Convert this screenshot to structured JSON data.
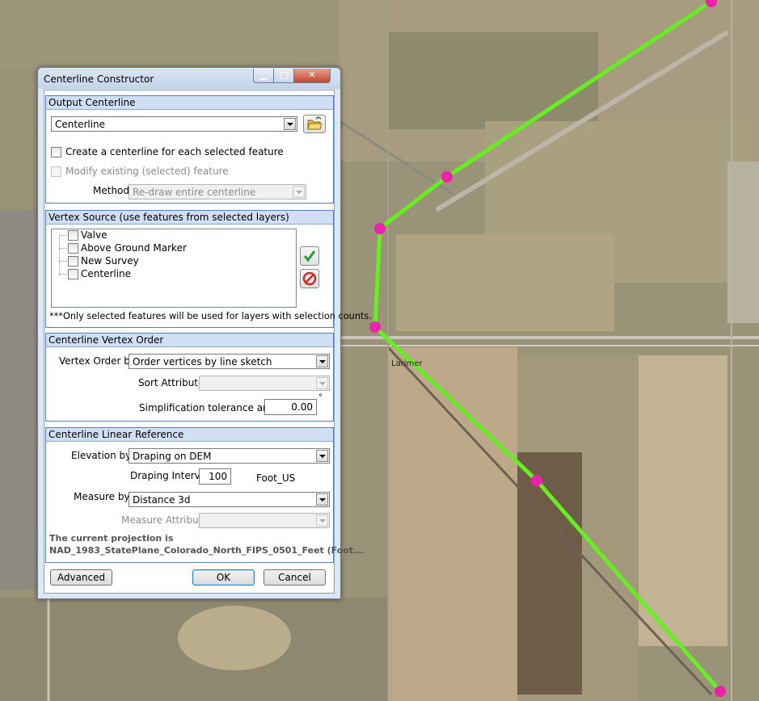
{
  "window": {
    "title": "Centerline Constructor"
  },
  "output": {
    "header": "Output Centerline",
    "layer_value": "Centerline",
    "create_each_label": "Create a centerline for each selected feature",
    "modify_label": "Modify existing (selected) feature",
    "method_label": "Method:",
    "method_value": "Re-draw entire centerline"
  },
  "vertex_source": {
    "header": "Vertex Source (use features from selected layers)",
    "layers": [
      "Valve",
      "Above Ground Marker",
      "New Survey",
      "Centerline"
    ],
    "note": "***Only selected features will be used for layers with selection counts."
  },
  "vertex_order": {
    "header": "Centerline Vertex Order",
    "order_label": "Vertex Order by:",
    "order_value": "Order vertices by line sketch",
    "sort_label": "Sort Attribute:",
    "sort_value": "",
    "tolerance_label": "Simplification tolerance angle:",
    "tolerance_value": "0.00",
    "degree": "°"
  },
  "linear_ref": {
    "header": "Centerline Linear Reference",
    "elevation_label": "Elevation by:",
    "elevation_value": "Draping on DEM",
    "interval_label": "Draping Interval:",
    "interval_value": "100",
    "unit": "Foot_US",
    "measure_label": "Measure by:",
    "measure_value": "Distance 3d",
    "measure_attr_label": "Measure Attribute:",
    "measure_attr_value": "",
    "projection_line1": "The current projection is",
    "projection_line2": "NAD_1983_StatePlane_Colorado_North_FIPS_0501_Feet (Foot..."
  },
  "buttons": {
    "advanced": "Advanced",
    "ok": "OK",
    "cancel": "Cancel"
  },
  "map": {
    "road_label": "Larimer",
    "line_color": "#66ee22",
    "vertex_color": "#ee22aa"
  }
}
